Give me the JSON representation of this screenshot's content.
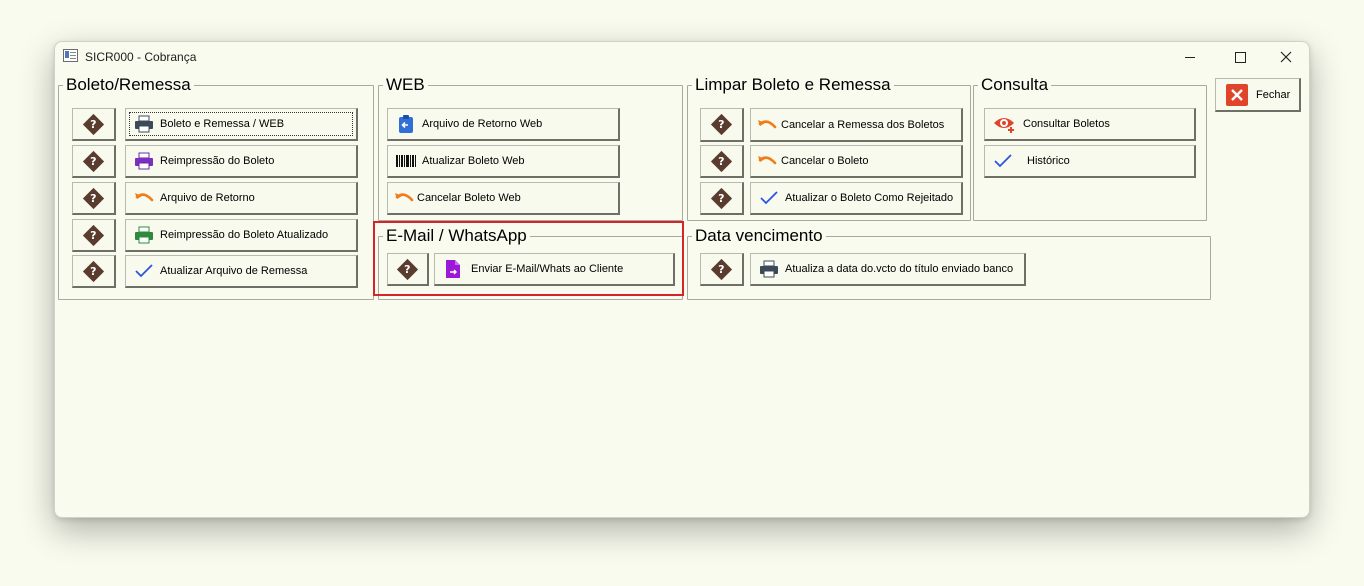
{
  "window": {
    "title": "SICR000 - Cobrança",
    "controls": {
      "minimize": "minimize",
      "maximize": "maximize",
      "close": "close"
    }
  },
  "groups": {
    "boleto_remessa": {
      "title": "Boleto/Remessa",
      "buttons": [
        {
          "label": "Boleto e Remessa  / WEB",
          "icon": "printer-icon"
        },
        {
          "label": "Reimpressão do Boleto",
          "icon": "printer-icon"
        },
        {
          "label": "Arquivo de Retorno",
          "icon": "undo-arrow-icon"
        },
        {
          "label": "Reimpressão do Boleto Atualizado",
          "icon": "printer-icon"
        },
        {
          "label": "Atualizar Arquivo de Remessa",
          "icon": "checkmark-icon"
        }
      ]
    },
    "web": {
      "title": "WEB",
      "buttons": [
        {
          "label": "Arquivo de Retorno Web",
          "icon": "clipboard-icon"
        },
        {
          "label": "Atualizar Boleto Web",
          "icon": "barcode-icon"
        },
        {
          "label": "Cancelar Boleto Web",
          "icon": "undo-arrow-icon"
        }
      ]
    },
    "limpar": {
      "title": "Limpar Boleto e Remessa",
      "buttons": [
        {
          "label": "Cancelar a Remessa dos Boletos",
          "icon": "undo-arrow-icon"
        },
        {
          "label": "Cancelar o Boleto",
          "icon": "undo-arrow-icon"
        },
        {
          "label": "Atualizar o Boleto Como Rejeitado",
          "icon": "checkmark-icon"
        }
      ]
    },
    "consulta": {
      "title": "Consulta",
      "buttons": [
        {
          "label": "Consultar Boletos",
          "icon": "eye-icon"
        },
        {
          "label": "Histórico",
          "icon": "checkmark-icon"
        }
      ]
    },
    "email": {
      "title": "E-Mail / WhatsApp",
      "buttons": [
        {
          "label": "Enviar E-Mail/Whats ao Cliente",
          "icon": "document-send-icon"
        }
      ]
    },
    "vencimento": {
      "title": "Data vencimento",
      "buttons": [
        {
          "label": "Atualiza a data do.vcto do título enviado banco",
          "icon": "printer-icon"
        }
      ]
    }
  },
  "help_button": {
    "glyph": "?"
  },
  "close_button": {
    "label": "Fechar",
    "icon": "close-x-icon"
  },
  "colors": {
    "background": "#f9fbef",
    "highlight_border": "#d7242b",
    "help_diamond": "#5a3c2e",
    "undo_orange": "#f07d1a",
    "check_blue": "#2b55e0",
    "close_red": "#e0442a",
    "purple": "#9b19d6"
  }
}
